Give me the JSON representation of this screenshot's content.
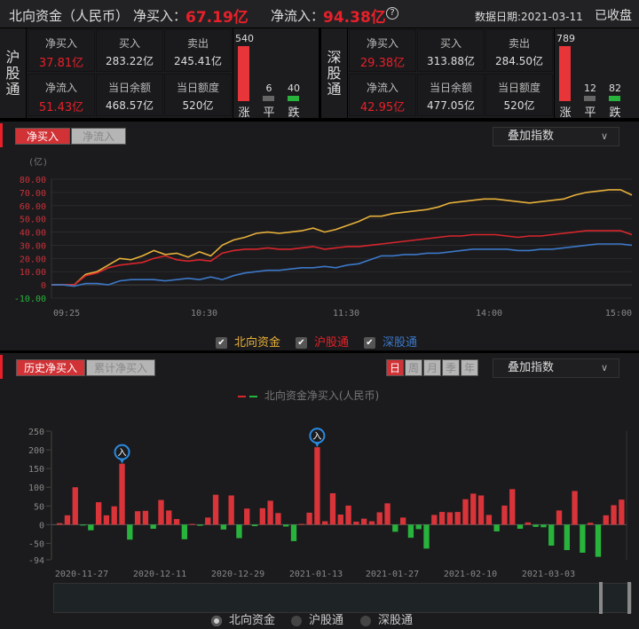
{
  "header": {
    "title": "北向资金（人民币）",
    "net_buy_label": "净买入：",
    "net_buy_value": "67.19亿",
    "net_inflow_label": "净流入：",
    "net_inflow_value": "94.38亿",
    "date_label": "数据日期:2021-03-11",
    "status": "已收盘"
  },
  "sh": {
    "name": "沪股通",
    "net_buy_label": "净买入",
    "net_buy": "37.81亿",
    "buy_label": "买入",
    "buy": "283.22亿",
    "sell_label": "卖出",
    "sell": "245.41亿",
    "net_inflow_label": "净流入",
    "net_inflow": "51.43亿",
    "balance_label": "当日余额",
    "balance": "468.57亿",
    "quota_label": "当日额度",
    "quota": "520亿",
    "up": 540,
    "flat": 6,
    "down": 40,
    "up_label": "涨",
    "flat_label": "平",
    "down_label": "跌"
  },
  "sz": {
    "name": "深股通",
    "net_buy_label": "净买入",
    "net_buy": "29.38亿",
    "buy_label": "买入",
    "buy": "313.88亿",
    "sell_label": "卖出",
    "sell": "284.50亿",
    "net_inflow_label": "净流入",
    "net_inflow": "42.95亿",
    "balance_label": "当日余额",
    "balance": "477.05亿",
    "quota_label": "当日额度",
    "quota": "520亿",
    "up": 789,
    "flat": 12,
    "down": 82,
    "up_label": "涨",
    "flat_label": "平",
    "down_label": "跌"
  },
  "intraday": {
    "tabs": [
      "净买入",
      "净流入"
    ],
    "overlay": "叠加指数",
    "legend": [
      "北向资金",
      "沪股通",
      "深股通"
    ]
  },
  "history": {
    "tabs": [
      "历史净买入",
      "累计净买入"
    ],
    "periods": [
      "日",
      "周",
      "月",
      "季",
      "年"
    ],
    "overlay": "叠加指数",
    "legend": "北向资金净买入(人民币)",
    "marker": "入",
    "radios": [
      "北向资金",
      "沪股通",
      "深股通"
    ]
  },
  "chart_data": [
    {
      "type": "line",
      "unit": "(亿)",
      "ylim": [
        -10,
        80
      ],
      "yticks": [
        "80.00",
        "70.00",
        "60.00",
        "50.00",
        "40.00",
        "30.00",
        "20.00",
        "10.00",
        "0",
        "-10.00"
      ],
      "xticks": [
        "09:25",
        "10:30",
        "11:30",
        "14:00",
        "15:00"
      ],
      "series": [
        {
          "name": "北向资金",
          "color": "#e8b03a",
          "values": [
            0,
            0,
            0,
            8,
            10,
            15,
            20,
            19,
            22,
            26,
            23,
            24,
            21,
            25,
            22,
            30,
            34,
            36,
            39,
            40,
            39,
            40,
            41,
            43,
            40,
            42,
            45,
            48,
            52,
            52,
            54,
            55,
            56,
            57,
            59,
            62,
            63,
            64,
            65,
            65,
            64,
            63,
            62,
            63,
            64,
            65,
            68,
            70,
            71,
            72,
            72,
            68
          ]
        },
        {
          "name": "沪股通",
          "color": "#d8262c",
          "values": [
            0,
            0,
            0,
            7,
            9,
            13,
            15,
            16,
            17,
            20,
            22,
            19,
            18,
            19,
            18,
            24,
            26,
            27,
            27,
            28,
            27,
            27,
            28,
            29,
            27,
            28,
            29,
            29,
            30,
            31,
            32,
            33,
            34,
            35,
            36,
            37,
            37,
            38,
            38,
            38,
            37,
            36,
            37,
            37,
            38,
            39,
            40,
            41,
            41,
            41,
            41,
            38
          ]
        },
        {
          "name": "深股通",
          "color": "#3c78c8",
          "values": [
            0,
            0,
            -1,
            1,
            1,
            0,
            3,
            4,
            4,
            4,
            3,
            4,
            5,
            4,
            6,
            4,
            7,
            9,
            10,
            11,
            11,
            12,
            13,
            13,
            14,
            13,
            15,
            16,
            19,
            22,
            22,
            23,
            23,
            24,
            24,
            25,
            26,
            27,
            27,
            27,
            27,
            26,
            26,
            27,
            27,
            28,
            29,
            30,
            31,
            31,
            31,
            30
          ]
        }
      ]
    },
    {
      "type": "bar",
      "title": "北向资金净买入(人民币)",
      "ylim": [
        -94,
        250
      ],
      "yticks": [
        "250",
        "200",
        "150",
        "100",
        "50",
        "0",
        "-50",
        "-94"
      ],
      "xticks": [
        "2020-11-27",
        "2020-12-11",
        "2020-12-29",
        "2021-01-13",
        "2021-01-27",
        "2021-02-10",
        "2021-03-03"
      ],
      "values": [
        4,
        25,
        100,
        -1,
        -15,
        60,
        25,
        49,
        163,
        -40,
        36,
        37,
        -11,
        66,
        38,
        15,
        -39,
        2,
        -3,
        19,
        80,
        -13,
        78,
        -36,
        43,
        -4,
        44,
        64,
        31,
        -5,
        -44,
        2,
        32,
        207,
        9,
        84,
        27,
        51,
        8,
        16,
        9,
        33,
        57,
        -19,
        19,
        -35,
        -12,
        -64,
        26,
        34,
        33,
        34,
        68,
        83,
        78,
        26,
        -18,
        51,
        95,
        -11,
        6,
        -6,
        -7,
        -56,
        38,
        -68,
        90,
        -75,
        5,
        -86,
        25,
        52,
        67
      ],
      "markers": [
        8,
        33
      ]
    }
  ]
}
